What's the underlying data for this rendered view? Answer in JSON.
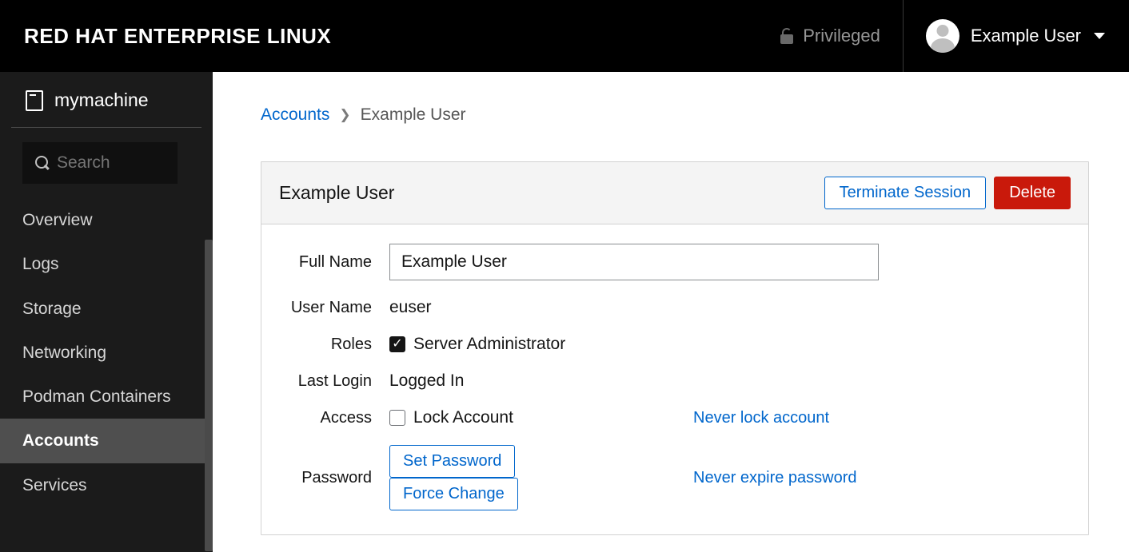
{
  "header": {
    "brand": "RED HAT ENTERPRISE LINUX",
    "privileged_label": "Privileged",
    "username": "Example User"
  },
  "sidebar": {
    "hostname": "mymachine",
    "search_placeholder": "Search",
    "items": [
      {
        "label": "Overview"
      },
      {
        "label": "Logs"
      },
      {
        "label": "Storage"
      },
      {
        "label": "Networking"
      },
      {
        "label": "Podman Containers"
      },
      {
        "label": "Accounts"
      },
      {
        "label": "Services"
      }
    ],
    "active_index": 5
  },
  "breadcrumb": {
    "root": "Accounts",
    "current": "Example User"
  },
  "account": {
    "title": "Example User",
    "actions": {
      "terminate": "Terminate Session",
      "delete": "Delete"
    },
    "labels": {
      "full_name": "Full Name",
      "user_name": "User Name",
      "roles": "Roles",
      "last_login": "Last Login",
      "access": "Access",
      "password": "Password"
    },
    "full_name": "Example User",
    "user_name": "euser",
    "role_label": "Server Administrator",
    "role_checked": true,
    "last_login": "Logged In",
    "lock_label": "Lock Account",
    "never_lock": "Never lock account",
    "set_password": "Set Password",
    "force_change": "Force Change",
    "never_expire": "Never expire password"
  }
}
